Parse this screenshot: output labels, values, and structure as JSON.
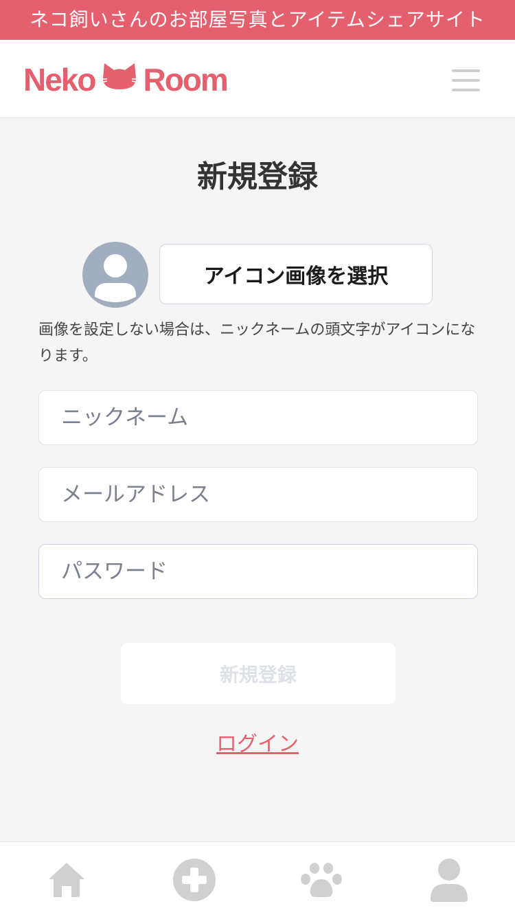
{
  "banner": {
    "text": "ネコ飼いさんのお部屋写真とアイテムシェアサイト"
  },
  "header": {
    "logo_left": "Neko",
    "logo_right": "Room",
    "menu_icon": "hamburger-menu-icon"
  },
  "page": {
    "title": "新規登録"
  },
  "avatar": {
    "icon": "default-user-avatar-icon",
    "color": "#a0aec0"
  },
  "icon_select": {
    "label": "アイコン画像を選択"
  },
  "note": {
    "text": "画像を設定しない場合は、ニックネームの頭文字がアイコンになります。"
  },
  "form": {
    "nickname": {
      "placeholder": "ニックネーム",
      "value": ""
    },
    "email": {
      "placeholder": "メールアドレス",
      "value": ""
    },
    "password": {
      "placeholder": "パスワード",
      "value": ""
    }
  },
  "submit": {
    "label": "新規登録",
    "state": "disabled"
  },
  "login_link": {
    "label": "ログイン"
  },
  "tabbar": {
    "items": [
      {
        "icon": "home-icon"
      },
      {
        "icon": "add-circle-icon"
      },
      {
        "icon": "paw-icon"
      },
      {
        "icon": "user-icon"
      }
    ]
  },
  "colors": {
    "brand": "#e5606e",
    "background": "#f5f5f5",
    "tab_icon": "#d0d0d0"
  }
}
